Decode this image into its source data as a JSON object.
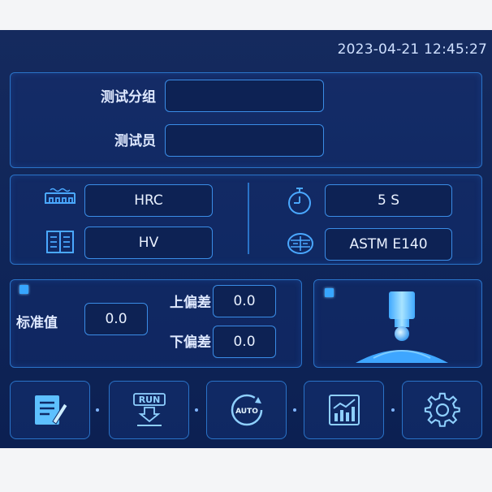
{
  "header": {
    "datetime": "2023-04-21 12:45:27"
  },
  "test_info": {
    "group_label": "测试分组",
    "group_value": "",
    "operator_label": "测试员",
    "operator_value": ""
  },
  "settings": {
    "scale": "HRC",
    "indenter_scale": "HV",
    "dwell_time": "5 S",
    "standard": "ASTM E140"
  },
  "tolerance": {
    "standard_label": "标准值",
    "standard_value": "0.0",
    "upper_label": "上偏差",
    "upper_value": "0.0",
    "lower_label": "下偏差",
    "lower_value": "0.0"
  },
  "toolbar": {
    "run_label": "RUN",
    "auto_label": "AUTO",
    "icons": [
      "edit-icon",
      "run-icon",
      "auto-icon",
      "chart-icon",
      "gear-icon"
    ]
  },
  "colors": {
    "background": "#0f2558",
    "border": "#2a73c8",
    "accent": "#37a6ff",
    "text": "#dfe9ff"
  }
}
